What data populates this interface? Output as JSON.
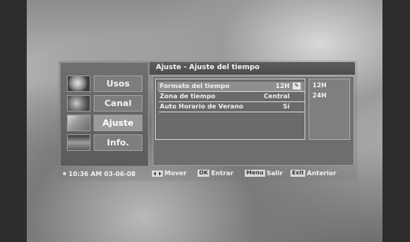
{
  "sidebar": {
    "items": [
      {
        "label": "Usos",
        "icon": "globe-icon"
      },
      {
        "label": "Canal",
        "icon": "satellite-icon"
      },
      {
        "label": "Ajuste",
        "icon": "settings-icon"
      },
      {
        "label": "Info.",
        "icon": "info-icon"
      }
    ],
    "active": "Ajuste",
    "clock": "10:36 AM 03-06-08"
  },
  "header": {
    "title": "Ajuste - Ajuste del tiempo"
  },
  "settings": [
    {
      "label": "Formato del tiempo",
      "value": "12H"
    },
    {
      "label": "Zona de tiempo",
      "value": "Central"
    },
    {
      "label": "Auto Horario de Verano",
      "value": "Sí"
    }
  ],
  "options": [
    "12H",
    "24H"
  ],
  "footer": {
    "move": "Mover",
    "ok_key": "OK",
    "ok_label": "Entrar",
    "menu_key": "Menu",
    "menu_label": "Salir",
    "exit_key": "Exit",
    "exit_label": "Anterior"
  },
  "colors": {
    "panel": "#6e6e6e",
    "highlight": "#8f8f8f",
    "text": "#f0f0f0"
  }
}
